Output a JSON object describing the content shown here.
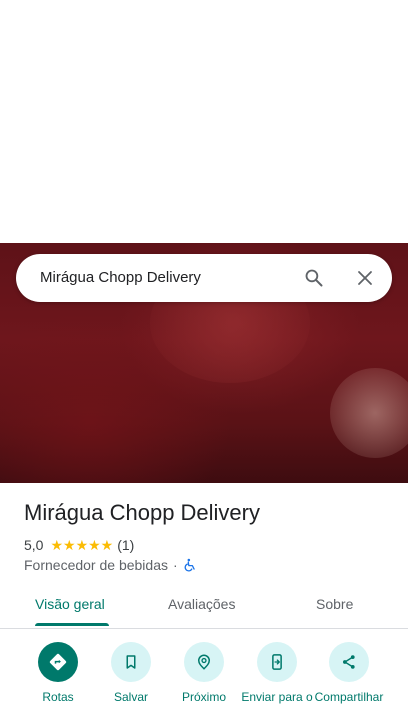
{
  "search": {
    "query": "Mirágua Chopp Delivery"
  },
  "place": {
    "name": "Mirágua Chopp Delivery",
    "rating": "5,0",
    "stars": "★★★★★",
    "review_count": "(1)",
    "category": "Fornecedor de bebidas",
    "separator": "·"
  },
  "tabs": [
    {
      "label": "Visão geral",
      "active": true
    },
    {
      "label": "Avaliações",
      "active": false
    },
    {
      "label": "Sobre",
      "active": false
    }
  ],
  "actions": [
    {
      "label": "Rotas",
      "icon": "directions-icon"
    },
    {
      "label": "Salvar",
      "icon": "bookmark-icon"
    },
    {
      "label": "Próximo",
      "icon": "nearby-icon"
    },
    {
      "label": "Enviar para o",
      "icon": "send-to-phone-icon"
    },
    {
      "label": "Compartilhar",
      "icon": "share-icon"
    }
  ],
  "colors": {
    "accent": "#00796b",
    "action_bg": "#d7f4f5",
    "star": "#fbbc04",
    "hero": "#6e161c"
  }
}
